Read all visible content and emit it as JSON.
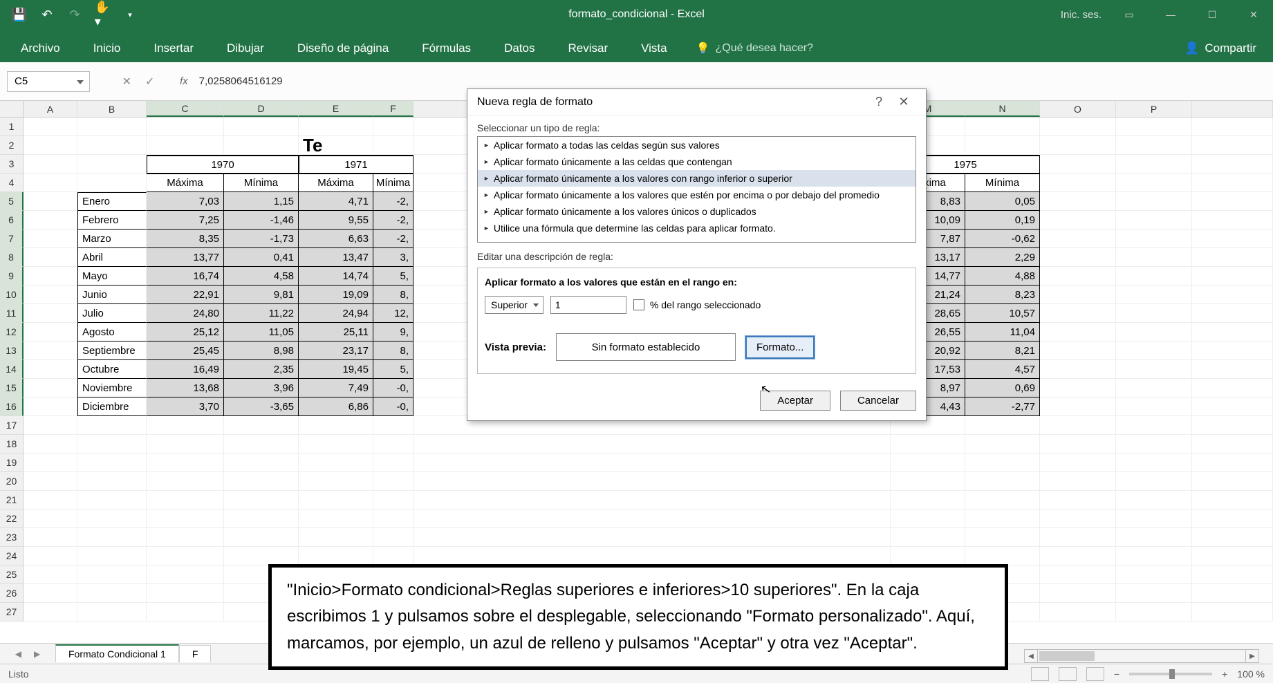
{
  "titlebar": {
    "title": "formato_condicional - Excel",
    "signin": "Inic. ses."
  },
  "ribbon": {
    "tabs": [
      "Archivo",
      "Inicio",
      "Insertar",
      "Dibujar",
      "Diseño de página",
      "Fórmulas",
      "Datos",
      "Revisar",
      "Vista"
    ],
    "tellme": "¿Qué desea hacer?",
    "share": "Compartir"
  },
  "formula": {
    "namebox": "C5",
    "fx": "fx",
    "value": "7,0258064516129"
  },
  "columns": [
    "A",
    "B",
    "C",
    "D",
    "E",
    "F",
    "M",
    "N",
    "O",
    "P"
  ],
  "rows": [
    "1",
    "2",
    "3",
    "4",
    "5",
    "6",
    "7",
    "8",
    "9",
    "10",
    "11",
    "12",
    "13",
    "14",
    "15",
    "16",
    "17",
    "18",
    "19",
    "20",
    "21",
    "22",
    "23",
    "24",
    "25",
    "26",
    "27"
  ],
  "sheet": {
    "big_title_partial": "Te",
    "years": {
      "y1970": "1970",
      "y1971": "1971",
      "y1975": "1975"
    },
    "headers": {
      "max": "Máxima",
      "min": "Mínima"
    },
    "months": [
      "Enero",
      "Febrero",
      "Marzo",
      "Abril",
      "Mayo",
      "Junio",
      "Julio",
      "Agosto",
      "Septiembre",
      "Octubre",
      "Noviembre",
      "Diciembre"
    ],
    "data": {
      "c": [
        "7,03",
        "7,25",
        "8,35",
        "13,77",
        "16,74",
        "22,91",
        "24,80",
        "25,12",
        "25,45",
        "16,49",
        "13,68",
        "3,70"
      ],
      "d": [
        "1,15",
        "-1,46",
        "-1,73",
        "0,41",
        "4,58",
        "9,81",
        "11,22",
        "11,05",
        "8,98",
        "2,35",
        "3,96",
        "-3,65"
      ],
      "e": [
        "4,71",
        "9,55",
        "6,63",
        "13,47",
        "14,74",
        "19,09",
        "24,94",
        "25,11",
        "23,17",
        "19,45",
        "7,49",
        "6,86"
      ],
      "f": [
        "-2,",
        "-2,",
        "-2,",
        "3,",
        "5,",
        "8,",
        "12,",
        "9,",
        "8,",
        "5,",
        "-0,",
        "-0,"
      ],
      "m": [
        "8,83",
        "10,09",
        "7,87",
        "13,17",
        "14,77",
        "21,24",
        "28,65",
        "26,55",
        "20,92",
        "17,53",
        "8,97",
        "4,43"
      ],
      "n": [
        "0,05",
        "0,19",
        "-0,62",
        "2,29",
        "4,88",
        "8,23",
        "10,57",
        "11,04",
        "8,21",
        "4,57",
        "0,69",
        "-2,77"
      ]
    }
  },
  "dialog": {
    "title": "Nueva regla de formato",
    "select_label": "Seleccionar un tipo de regla:",
    "rules": [
      "Aplicar formato a todas las celdas según sus valores",
      "Aplicar formato únicamente a las celdas que contengan",
      "Aplicar formato únicamente a los valores con rango inferior o superior",
      "Aplicar formato únicamente a los valores que estén por encima o por debajo del promedio",
      "Aplicar formato únicamente a los valores únicos o duplicados",
      "Utilice una fórmula que determine las celdas para aplicar formato."
    ],
    "edit_label": "Editar una descripción de regla:",
    "desc_title": "Aplicar formato a los valores que están en el rango en:",
    "direction": "Superior",
    "value": "1",
    "pct_label": "% del rango seleccionado",
    "preview_label": "Vista previa:",
    "preview_text": "Sin formato establecido",
    "format_btn": "Formato...",
    "ok": "Aceptar",
    "cancel": "Cancelar"
  },
  "annotation": "\"Inicio>Formato condicional>Reglas superiores e inferiores>10 superiores\". En la caja escribimos 1 y pulsamos sobre el desplegable, seleccionando \"Formato personalizado\". Aquí, marcamos, por ejemplo, un azul de relleno y pulsamos \"Aceptar\" y otra vez \"Aceptar\".",
  "sheettabs": {
    "active": "Formato Condicional 1",
    "next_partial": "F"
  },
  "statusbar": {
    "ready": "Listo",
    "zoom": "100 %"
  },
  "colwidths": {
    "A": 78,
    "B": 100,
    "C": 112,
    "D": 108,
    "E": 108,
    "F": 58,
    "M": 108,
    "N": 108,
    "O": 110,
    "P": 110,
    "blank": 690
  }
}
